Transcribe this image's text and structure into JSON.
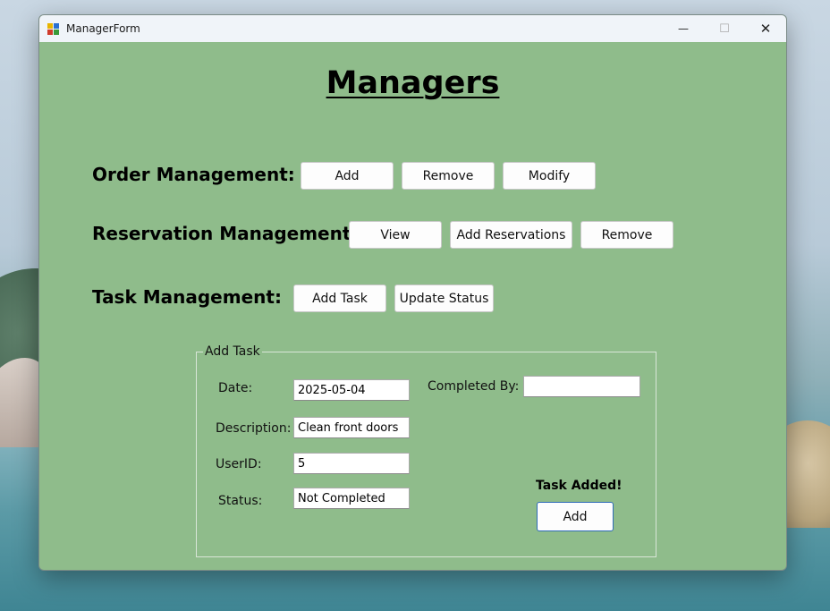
{
  "window": {
    "title": "ManagerForm",
    "minimize": "—",
    "maximize": "☐",
    "close": "✕"
  },
  "heading": "Managers",
  "order_management": {
    "label": "Order Management:",
    "buttons": [
      "Add",
      "Remove",
      "Modify"
    ]
  },
  "reservation_management": {
    "label": "Reservation Management:",
    "buttons": [
      "View",
      "Add Reservations",
      "Remove"
    ]
  },
  "task_management": {
    "label": "Task Management:",
    "buttons": [
      "Add Task",
      "Update Status"
    ]
  },
  "add_task": {
    "group_title": "Add Task",
    "date_label": "Date:",
    "date_value": "2025-05-04",
    "description_label": "Description:",
    "description_value": "Clean front doors",
    "userid_label": "UserID:",
    "userid_value": "5",
    "status_label": "Status:",
    "status_value": "Not Completed",
    "completed_by_label": "Completed By:",
    "completed_by_value": "",
    "message": "Task Added!",
    "add_button": "Add"
  },
  "colors": {
    "form_background": "#8fbc8b",
    "accent_border": "#2e6bb8"
  }
}
